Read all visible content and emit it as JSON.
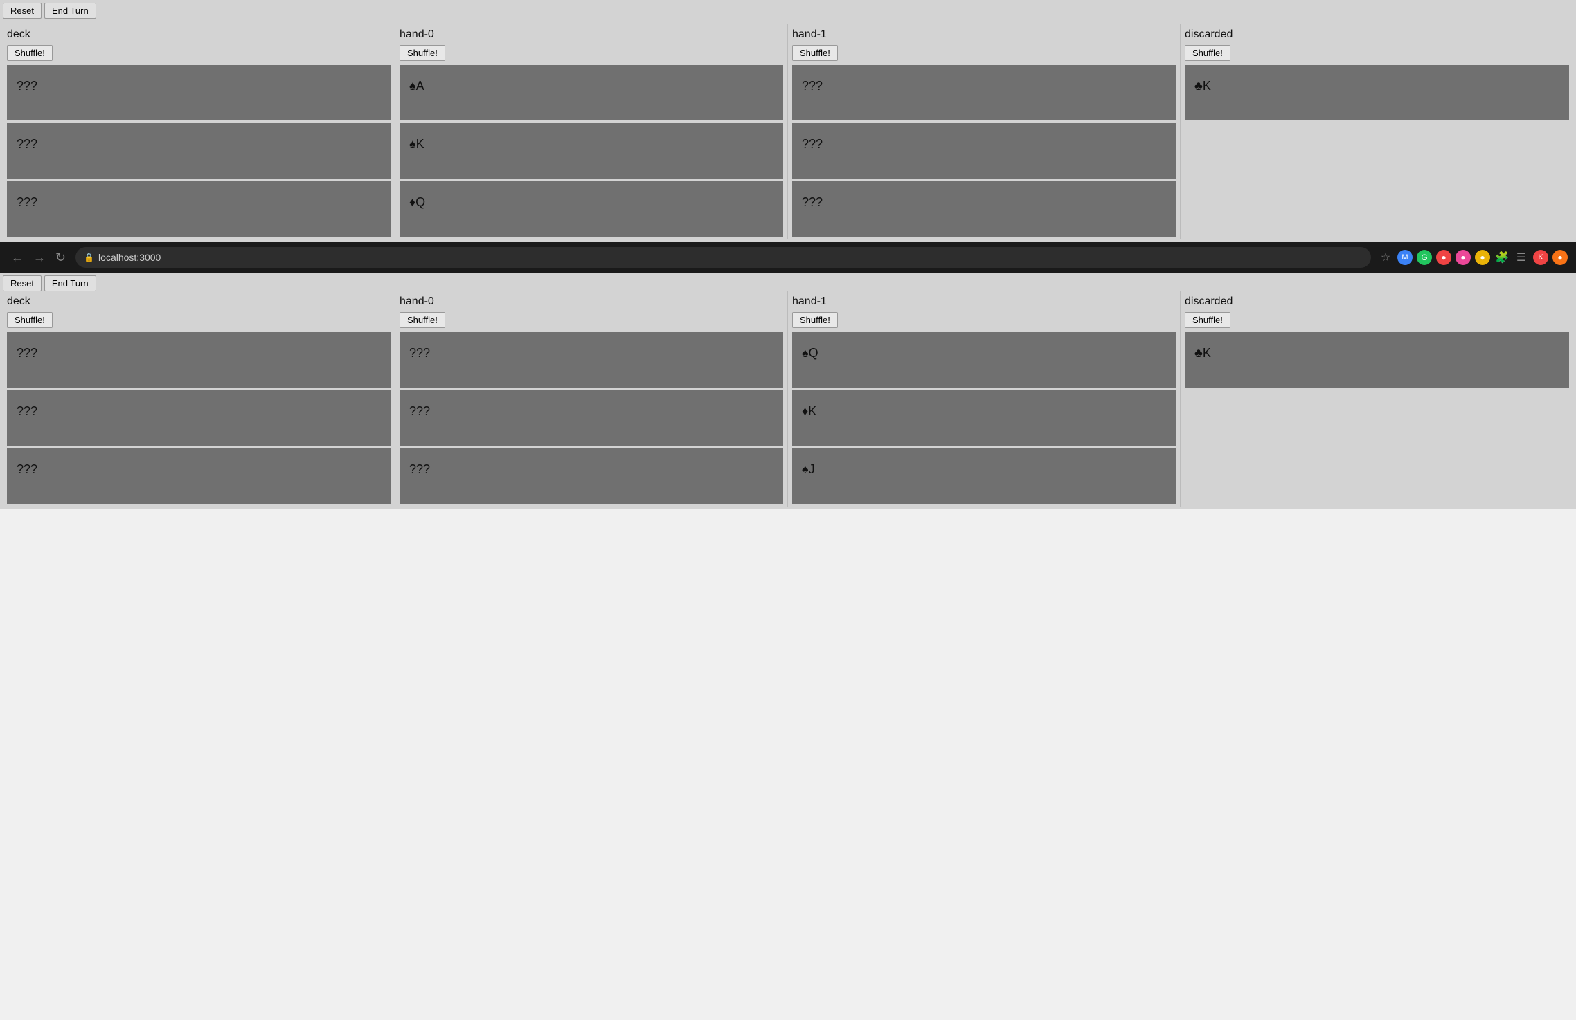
{
  "toolbar": {
    "reset_label": "Reset",
    "end_turn_label": "End Turn"
  },
  "top_game": {
    "columns": [
      {
        "title": "deck",
        "shuffle_label": "Shuffle!",
        "cards": [
          {
            "text": "???",
            "visible": false
          },
          {
            "text": "???",
            "visible": false
          },
          {
            "text": "???",
            "visible": false
          }
        ]
      },
      {
        "title": "hand-0",
        "shuffle_label": "Shuffle!",
        "cards": [
          {
            "text": "♠A",
            "visible": true
          },
          {
            "text": "♠K",
            "visible": true
          },
          {
            "text": "♦Q",
            "visible": true
          }
        ]
      },
      {
        "title": "hand-1",
        "shuffle_label": "Shuffle!",
        "cards": [
          {
            "text": "???",
            "visible": false
          },
          {
            "text": "???",
            "visible": false
          },
          {
            "text": "???",
            "visible": false
          }
        ]
      },
      {
        "title": "discarded",
        "shuffle_label": "Shuffle!",
        "cards": [
          {
            "text": "♣K",
            "visible": true
          }
        ]
      }
    ]
  },
  "browser": {
    "url": "localhost:3000",
    "back_label": "←",
    "forward_label": "→",
    "reload_label": "↻"
  },
  "bottom_game": {
    "columns": [
      {
        "title": "deck",
        "shuffle_label": "Shuffle!",
        "cards": [
          {
            "text": "???",
            "visible": false
          },
          {
            "text": "???",
            "visible": false
          },
          {
            "text": "???",
            "visible": false
          }
        ]
      },
      {
        "title": "hand-0",
        "shuffle_label": "Shuffle!",
        "cards": [
          {
            "text": "???",
            "visible": false
          },
          {
            "text": "???",
            "visible": false
          },
          {
            "text": "???",
            "visible": false
          }
        ]
      },
      {
        "title": "hand-1",
        "shuffle_label": "Shuffle!",
        "cards": [
          {
            "text": "♠Q",
            "visible": true
          },
          {
            "text": "♦K",
            "visible": true
          },
          {
            "text": "♠J",
            "visible": true
          }
        ]
      },
      {
        "title": "discarded",
        "shuffle_label": "Shuffle!",
        "cards": [
          {
            "text": "♣K",
            "visible": true
          }
        ]
      }
    ]
  }
}
